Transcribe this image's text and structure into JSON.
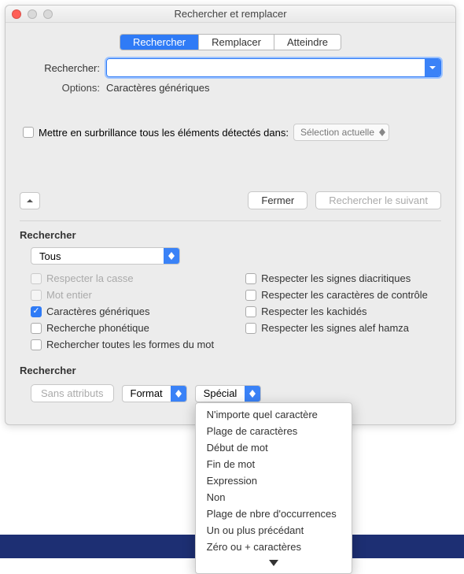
{
  "window": {
    "title": "Rechercher et remplacer"
  },
  "tabs": {
    "search": "Rechercher",
    "replace": "Remplacer",
    "goto": "Atteindre"
  },
  "search_row": {
    "label": "Rechercher:",
    "value": ""
  },
  "options_row": {
    "label": "Options:",
    "value": "Caractères génériques"
  },
  "highlight": {
    "label": "Mettre en surbrillance tous les éléments détectés dans:",
    "select": "Sélection actuelle"
  },
  "actions": {
    "close": "Fermer",
    "find_next": "Rechercher le suivant"
  },
  "section1_title": "Rechercher",
  "scope_select": "Tous",
  "checks_left": [
    {
      "label": "Respecter la casse",
      "checked": false,
      "disabled": true
    },
    {
      "label": "Mot entier",
      "checked": false,
      "disabled": true
    },
    {
      "label": "Caractères génériques",
      "checked": true,
      "disabled": false
    },
    {
      "label": "Recherche phonétique",
      "checked": false,
      "disabled": false
    },
    {
      "label": "Rechercher toutes les formes du mot",
      "checked": false,
      "disabled": false
    }
  ],
  "checks_right": [
    {
      "label": "Respecter les signes diacritiques",
      "checked": false
    },
    {
      "label": "Respecter les caractères de contrôle",
      "checked": false
    },
    {
      "label": "Respecter les kachidés",
      "checked": false
    },
    {
      "label": "Respecter les signes alef hamza",
      "checked": false
    }
  ],
  "section2_title": "Rechercher",
  "format_row": {
    "no_attrs": "Sans attributs",
    "format": "Format",
    "special": "Spécial"
  },
  "special_menu": [
    "N'importe quel caractère",
    "Plage de caractères",
    "Début de mot",
    "Fin de mot",
    "Expression",
    "Non",
    "Plage de nbre d'occurrences",
    "Un ou plus précédant",
    "Zéro ou + caractères"
  ]
}
